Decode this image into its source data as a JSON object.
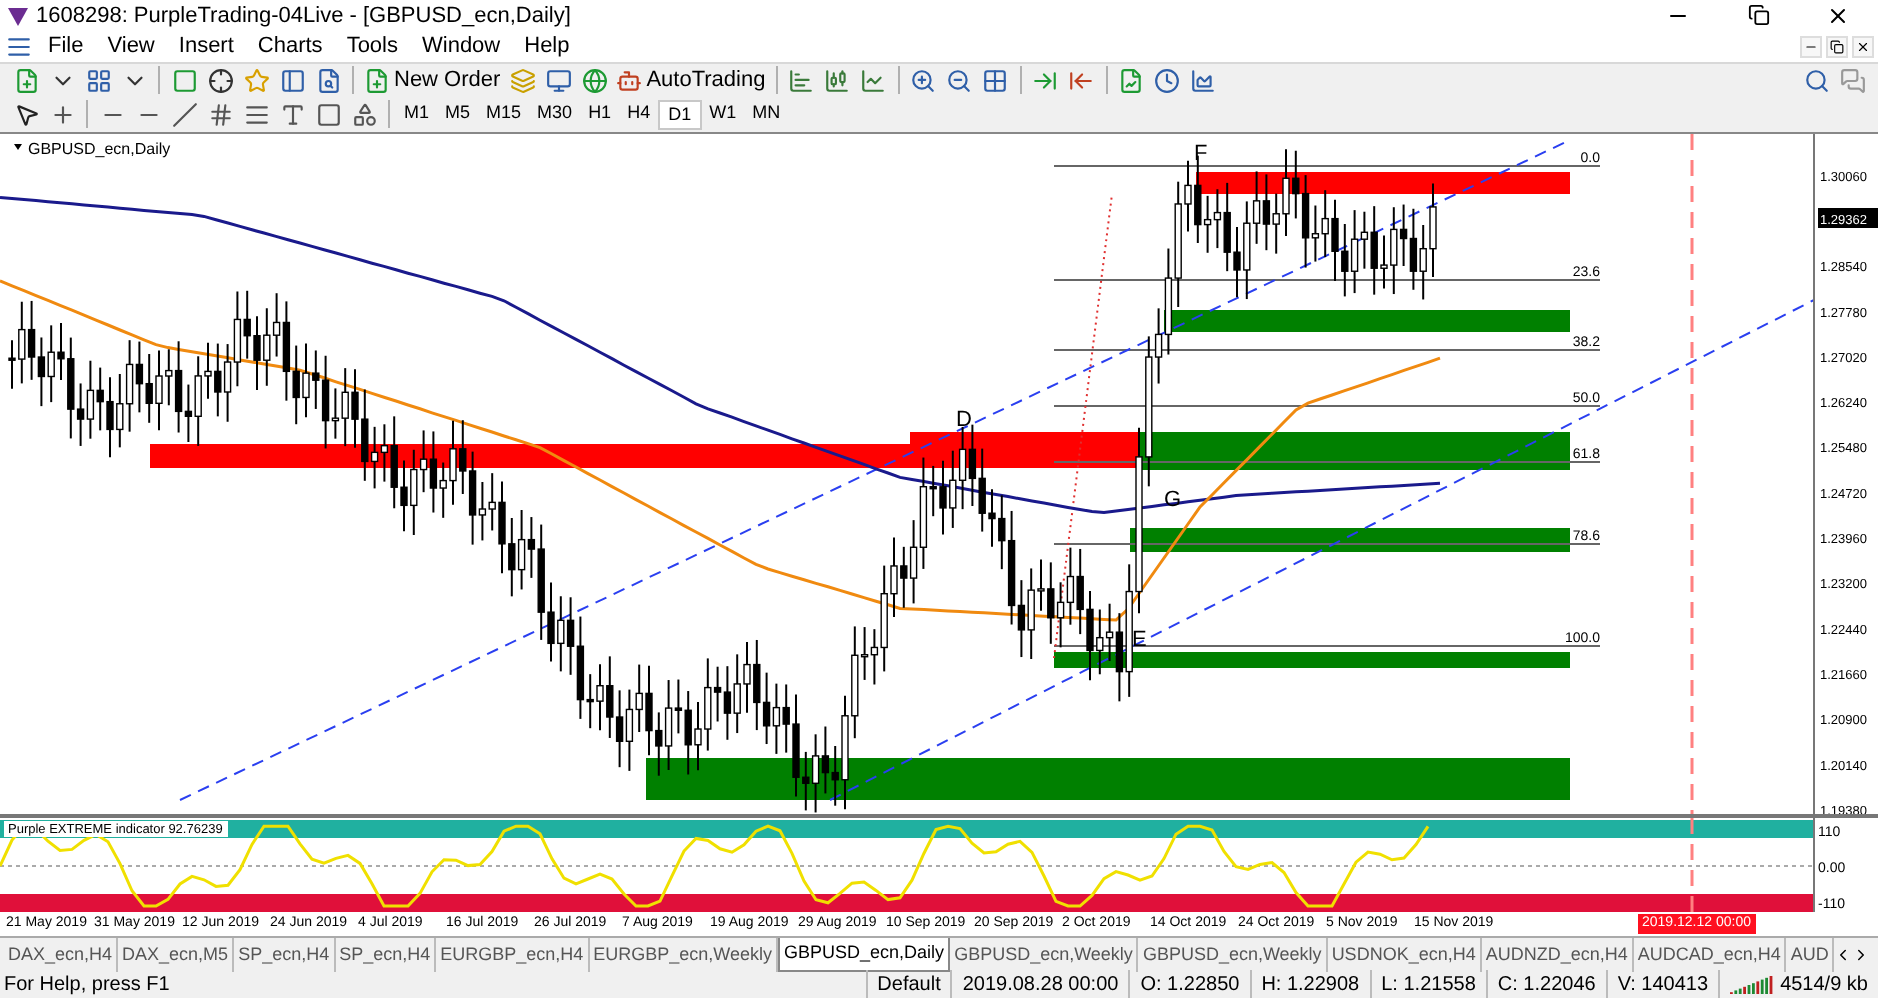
{
  "window": {
    "title": "1608298: PurpleTrading-04Live - [GBPUSD_ecn,Daily]"
  },
  "menu": [
    "File",
    "View",
    "Insert",
    "Charts",
    "Tools",
    "Window",
    "Help"
  ],
  "toolbar": {
    "new_order": "New Order",
    "autotrading": "AutoTrading"
  },
  "timeframes": [
    {
      "label": "M1",
      "selected": false
    },
    {
      "label": "M5",
      "selected": false
    },
    {
      "label": "M15",
      "selected": false
    },
    {
      "label": "M30",
      "selected": false
    },
    {
      "label": "H1",
      "selected": false
    },
    {
      "label": "H4",
      "selected": false
    },
    {
      "label": "D1",
      "selected": true
    },
    {
      "label": "W1",
      "selected": false
    },
    {
      "label": "MN",
      "selected": false
    }
  ],
  "chart": {
    "symbol_label": "GBPUSD_ecn,Daily",
    "price_labels": [
      "1.30060",
      "1.28540",
      "1.27780",
      "1.27020",
      "1.26240",
      "1.25480",
      "1.24720",
      "1.23960",
      "1.23200",
      "1.22440",
      "1.21660",
      "1.20900",
      "1.20140",
      "1.19380"
    ],
    "current_price": "1.29362",
    "wave_labels": [
      "F",
      "D",
      "G",
      "E"
    ],
    "fib_levels": [
      "0.0",
      "23.6",
      "38.2",
      "50.0",
      "61.8",
      "78.6",
      "100.0"
    ]
  },
  "indicator": {
    "name": "Purple EXTREME indicator 92.76239",
    "levels": [
      "110",
      "0.00",
      "-110"
    ]
  },
  "time_axis": {
    "labels": [
      "21 May 2019",
      "31 May 2019",
      "12 Jun 2019",
      "24 Jun 2019",
      "4 Jul 2019",
      "16 Jul 2019",
      "26 Jul 2019",
      "7 Aug 2019",
      "19 Aug 2019",
      "29 Aug 2019",
      "10 Sep 2019",
      "20 Sep 2019",
      "2 Oct 2019",
      "14 Oct 2019",
      "24 Oct 2019",
      "5 Nov 2019",
      "15 Nov 2019"
    ],
    "marker": "2019.12.12 00:00"
  },
  "tabs": [
    {
      "label": "DAX_ecn,H4",
      "selected": false
    },
    {
      "label": "DAX_ecn,M5",
      "selected": false
    },
    {
      "label": "SP_ecn,H4",
      "selected": false
    },
    {
      "label": "SP_ecn,H4",
      "selected": false
    },
    {
      "label": "EURGBP_ecn,H4",
      "selected": false
    },
    {
      "label": "EURGBP_ecn,Weekly",
      "selected": false
    },
    {
      "label": "GBPUSD_ecn,Daily",
      "selected": true
    },
    {
      "label": "GBPUSD_ecn,Weekly",
      "selected": false
    },
    {
      "label": "GBPUSD_ecn,Weekly",
      "selected": false
    },
    {
      "label": "USDNOK_ecn,H4",
      "selected": false
    },
    {
      "label": "AUDNZD_ecn,H4",
      "selected": false
    },
    {
      "label": "AUDCAD_ecn,H4",
      "selected": false
    },
    {
      "label": "AUD",
      "selected": false
    }
  ],
  "status_bar": {
    "help": "For Help, press F1",
    "fields": [
      "Default",
      "2019.08.28 00:00",
      "O: 1.22850",
      "H: 1.22908",
      "L: 1.21558",
      "C: 1.22046",
      "V: 140413"
    ],
    "traffic": "4514/9 kb"
  }
}
